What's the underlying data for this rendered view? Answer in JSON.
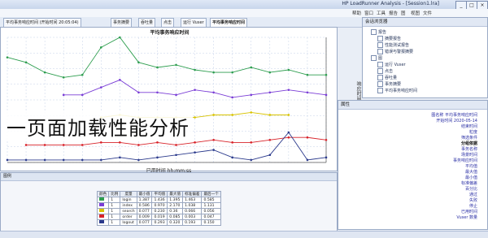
{
  "window": {
    "title": "HP LoadRunner Analysis - [Session1.lra]",
    "controls": [
      "_",
      "□",
      "×"
    ]
  },
  "menu": [
    "文件",
    "视图",
    "图",
    "报告",
    "工具",
    "窗口",
    "帮助"
  ],
  "toolbar": {
    "tabs": [
      "平均事务响应时间",
      "运行 Vuser",
      "点击",
      "吞吐量",
      "事务摘要",
      "平均事务响应时间 (开始时间 20:05:04)"
    ],
    "active_tab": 0
  },
  "overlay_caption": "一页面加载性能分析",
  "chart": {
    "title": "平均事务响应时间",
    "x_axis_title": "已用时间 hh:mm:ss",
    "y_axis_title": "响应时间 (秒)",
    "colors": {
      "green": "#2e9e4f",
      "purple": "#7a3dd6",
      "yellow": "#d8c300",
      "red": "#d8232a",
      "navy": "#2b3a8c",
      "bg": "#ffffff",
      "grid": "#c4d2e8"
    }
  },
  "chart_data": {
    "type": "line",
    "title": "平均事务响应时间",
    "xlabel": "已用时间 hh:mm:ss",
    "ylabel": "响应时间 (秒)",
    "x": [
      0,
      1,
      2,
      3,
      4,
      5,
      6,
      7,
      8,
      9,
      10,
      11,
      12,
      13,
      14,
      15,
      16,
      17
    ],
    "xlim": [
      0,
      17
    ],
    "ylim": [
      0,
      5
    ],
    "grid": true,
    "series": [
      {
        "color": "#2e9e4f",
        "values": [
          4.2,
          4.0,
          3.6,
          3.4,
          3.5,
          4.6,
          5.0,
          4.0,
          3.8,
          3.9,
          3.7,
          3.6,
          3.6,
          3.8,
          3.6,
          3.7,
          3.5,
          3.5
        ]
      },
      {
        "color": "#7a3dd6",
        "values": [
          null,
          null,
          null,
          2.7,
          2.7,
          3.0,
          3.3,
          2.8,
          2.8,
          2.7,
          2.9,
          2.8,
          2.6,
          2.7,
          2.8,
          2.9,
          2.8,
          2.7
        ]
      },
      {
        "color": "#d8c300",
        "values": [
          null,
          null,
          null,
          null,
          null,
          1.8,
          1.9,
          1.8,
          1.8,
          1.8,
          1.8,
          1.9,
          1.9,
          2.0,
          1.9,
          1.9,
          null,
          null
        ]
      },
      {
        "color": "#d8232a",
        "values": [
          null,
          0.7,
          0.7,
          0.7,
          0.7,
          0.8,
          0.8,
          0.7,
          0.8,
          0.7,
          0.8,
          0.9,
          0.8,
          0.8,
          0.9,
          1.0,
          1.0,
          0.9
        ]
      },
      {
        "color": "#2b3a8c",
        "values": [
          0.1,
          0.1,
          0.1,
          0.1,
          0.1,
          0.1,
          0.2,
          0.1,
          0.2,
          0.3,
          0.4,
          0.5,
          0.2,
          0.1,
          0.3,
          1.2,
          0.1,
          0.2
        ]
      }
    ]
  },
  "right_panel": {
    "header": "会话浏览器",
    "items": [
      "报告",
      "摘要报告",
      "性能测试报告",
      "错误与警报摘要",
      "图",
      "运行 Vuser",
      "点击",
      "吞吐量",
      "事务摘要",
      "平均事务响应时间"
    ]
  },
  "properties_panel": {
    "header": "属性",
    "items": [
      "图名称 平均事务响应时间",
      "开始时间 2020-05-14",
      "结束时间",
      "粒度",
      "筛选条件",
      "分组依据",
      "事务名称",
      "场景时间",
      "事务响应时间",
      "平均值",
      "最大值",
      "最小值",
      "标准偏差",
      "百分比",
      "通过",
      "失败",
      "停止",
      "已用时间",
      "Vuser 数量"
    ]
  },
  "bottom_panel": {
    "header": "图例",
    "columns": [
      "颜色",
      "比例",
      "度量",
      "最小值",
      "平均值",
      "最大值",
      "标准偏差",
      "最后一个"
    ],
    "rows": [
      [
        "",
        "1",
        "login",
        "1.387",
        "1.436",
        "1.395",
        "1.463",
        "0.585"
      ],
      [
        "",
        "1",
        "index",
        "0.586",
        "0.970",
        "2.170",
        "1.038",
        "1.131"
      ],
      [
        "",
        "1",
        "search",
        "0.077",
        "0.230",
        "0.36",
        "0.066",
        "0.056"
      ],
      [
        "",
        "1",
        "order",
        "0.009",
        "0.019",
        "0.085",
        "0.003",
        "0.047"
      ],
      [
        "",
        "1",
        "logout",
        "0.077",
        "0.293",
        "0.320",
        "0.193",
        "0.150"
      ]
    ]
  }
}
